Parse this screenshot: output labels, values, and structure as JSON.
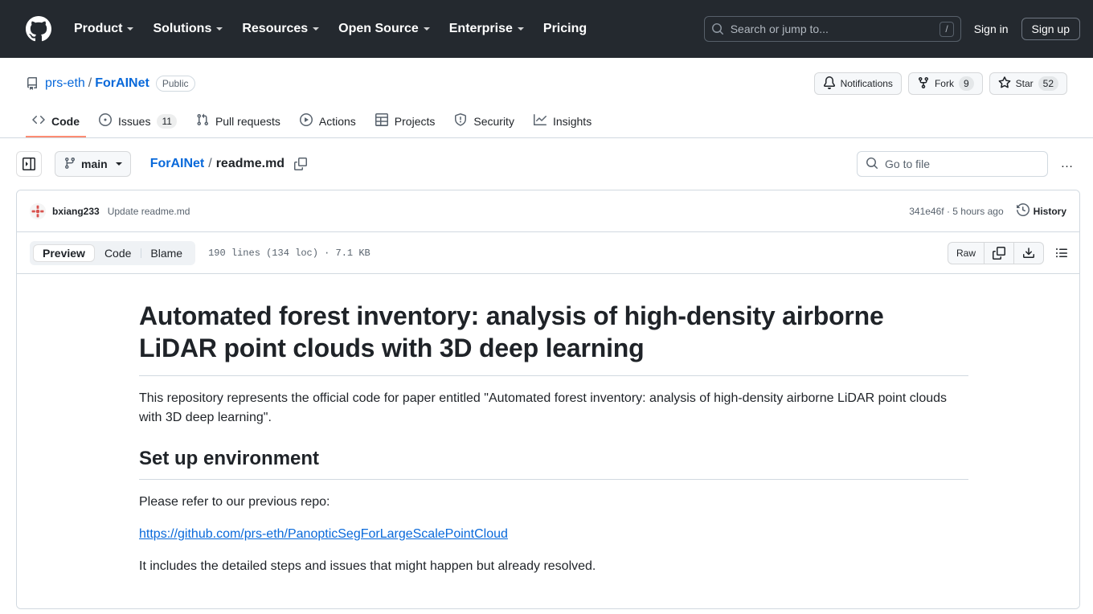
{
  "global_header": {
    "logo_icon": "github-mark-icon",
    "nav": [
      {
        "label": "Product",
        "has_caret": true
      },
      {
        "label": "Solutions",
        "has_caret": true
      },
      {
        "label": "Resources",
        "has_caret": true
      },
      {
        "label": "Open Source",
        "has_caret": true
      },
      {
        "label": "Enterprise",
        "has_caret": true
      },
      {
        "label": "Pricing",
        "has_caret": false
      }
    ],
    "search": {
      "placeholder": "Search or jump to...",
      "shortcut": "/",
      "icon": "search-icon"
    },
    "sign_in": "Sign in",
    "sign_up": "Sign up",
    "background": "#24292f"
  },
  "repo": {
    "icon": "repo-icon",
    "owner": "prs-eth",
    "separator": "/",
    "name": "ForAINet",
    "visibility": "Public",
    "actions": [
      {
        "label": "Notifications",
        "icon": "bell-icon",
        "count": null
      },
      {
        "label": "Fork",
        "icon": "fork-icon",
        "count": "9"
      },
      {
        "label": "Star",
        "icon": "star-icon",
        "count": "52"
      }
    ],
    "tabs": [
      {
        "label": "Code",
        "icon": "code-icon",
        "count": null,
        "active": true
      },
      {
        "label": "Issues",
        "icon": "issue-opened-icon",
        "count": "11",
        "active": false
      },
      {
        "label": "Pull requests",
        "icon": "git-pull-request-icon",
        "count": null,
        "active": false
      },
      {
        "label": "Actions",
        "icon": "play-icon",
        "count": null,
        "active": false
      },
      {
        "label": "Projects",
        "icon": "table-icon",
        "count": null,
        "active": false
      },
      {
        "label": "Security",
        "icon": "shield-icon",
        "count": null,
        "active": false
      },
      {
        "label": "Insights",
        "icon": "graph-icon",
        "count": null,
        "active": false
      }
    ],
    "active_tab_underline_color": "#fd8c73"
  },
  "file_nav": {
    "sidebar_toggle_icon": "sidebar-expand-icon",
    "branch": "main",
    "branch_icon": "git-branch-icon",
    "breadcrumb": {
      "root": "ForAINet",
      "separator": "/",
      "current": "readme.md",
      "copy_icon": "copy-path-icon"
    },
    "go_to_file": {
      "placeholder": "Go to file",
      "icon": "search-icon"
    },
    "more_menu": "…"
  },
  "commit": {
    "avatar": "user-avatar",
    "author": "bxiang233",
    "message": "Update readme.md",
    "hash_and_time": "341e46f · 5 hours ago",
    "history_label": "History",
    "history_icon": "history-icon"
  },
  "file_toolbar": {
    "views": [
      {
        "label": "Preview",
        "active": true
      },
      {
        "label": "Code",
        "active": false
      },
      {
        "label": "Blame",
        "active": false
      }
    ],
    "meta": "190 lines (134 loc) · 7.1 KB",
    "raw_label": "Raw",
    "copy_icon": "copy-icon",
    "download_icon": "download-icon",
    "outline_icon": "outline-list-icon"
  },
  "readme": {
    "h1": "Automated forest inventory: analysis of high-density airborne LiDAR point clouds with 3D deep learning",
    "p1": "This repository represents the official code for paper entitled \"Automated forest inventory: analysis of high-density airborne LiDAR point clouds with 3D deep learning\".",
    "h2": "Set up environment",
    "p2": "Please refer to our previous repo:",
    "link": "https://github.com/prs-eth/PanopticSegForLargeScalePointCloud",
    "p3": "It includes the detailed steps and issues that might happen but already resolved."
  }
}
